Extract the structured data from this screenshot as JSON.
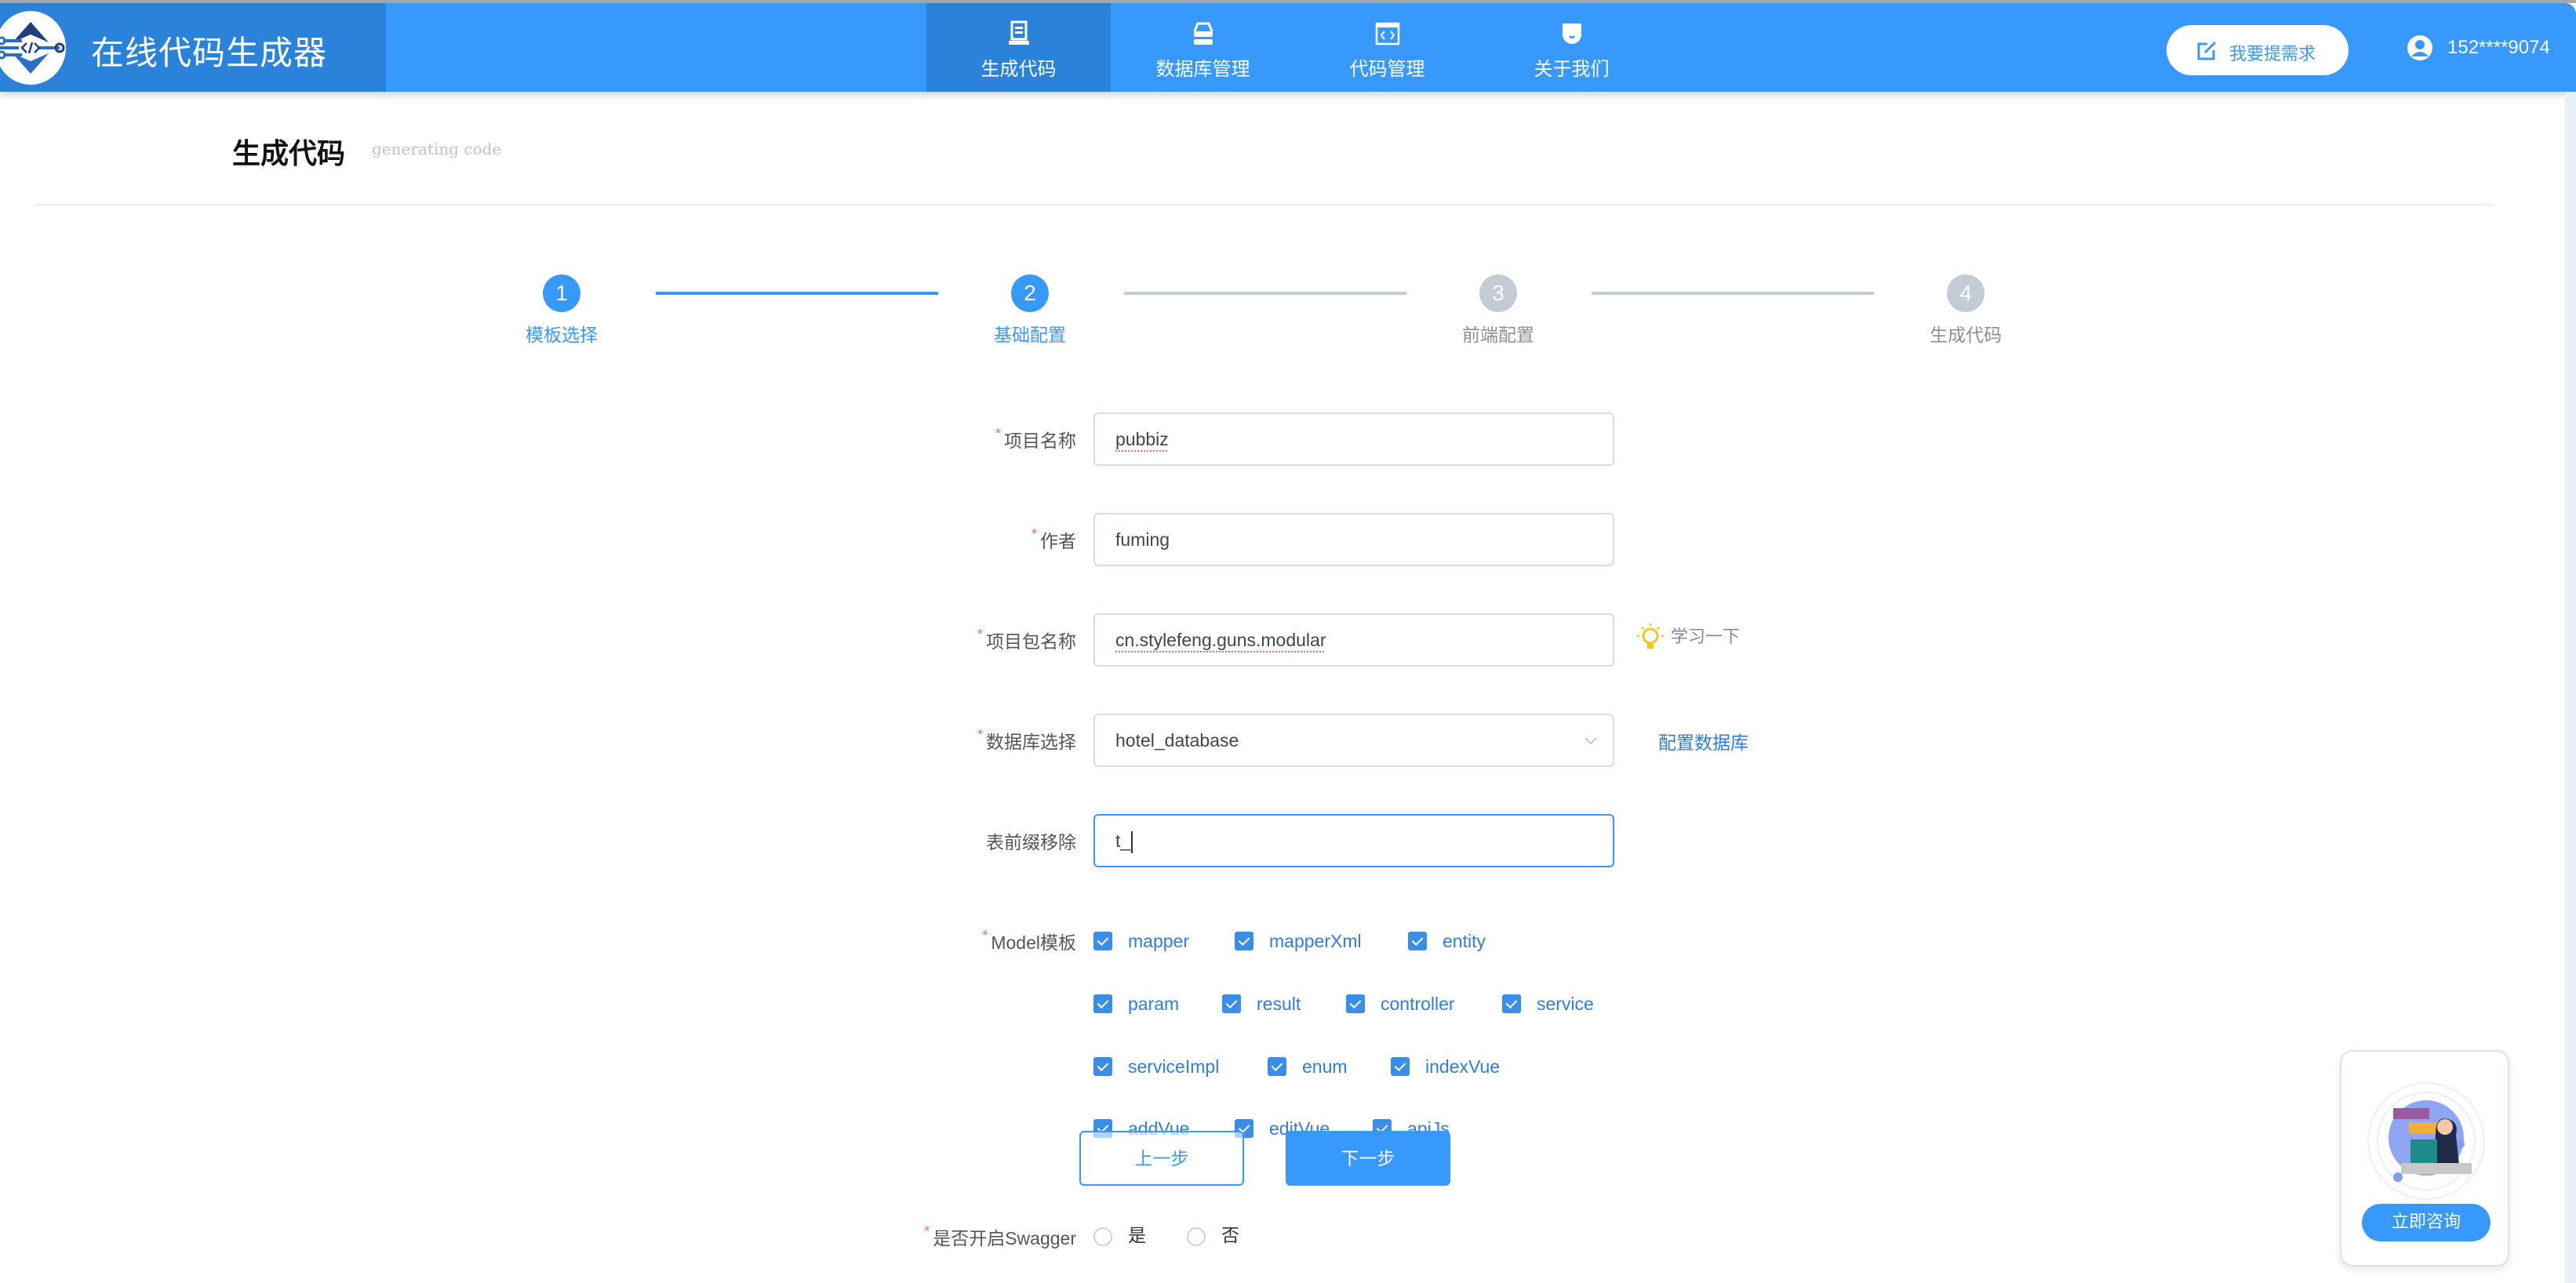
{
  "app": {
    "title": "在线代码生成器",
    "logo_icon": "circuit-code-logo"
  },
  "nav": {
    "items": [
      {
        "label": "生成代码",
        "icon": "monitor-icon",
        "active": true
      },
      {
        "label": "数据库管理",
        "icon": "database-icon",
        "active": false
      },
      {
        "label": "代码管理",
        "icon": "code-window-icon",
        "active": false
      },
      {
        "label": "关于我们",
        "icon": "about-icon",
        "active": false
      }
    ]
  },
  "header_right": {
    "request_button": "我要提需求",
    "request_icon": "edit-icon",
    "user_icon": "user-icon",
    "user_phone": "152****9074"
  },
  "page": {
    "title": "生成代码",
    "subtitle": "generating code"
  },
  "steps": [
    {
      "number": "1",
      "label": "模板选择",
      "status": "done"
    },
    {
      "number": "2",
      "label": "基础配置",
      "status": "done"
    },
    {
      "number": "3",
      "label": "前端配置",
      "status": "todo"
    },
    {
      "number": "4",
      "label": "生成代码",
      "status": "todo"
    }
  ],
  "form": {
    "project_name": {
      "label": "项目名称",
      "required": true,
      "value": "pubbiz"
    },
    "author": {
      "label": "作者",
      "required": true,
      "value": "fuming"
    },
    "package_name": {
      "label": "项目包名称",
      "required": true,
      "value": "cn.stylefeng.guns.modular",
      "hint": "学习一下",
      "hint_icon": "lightbulb-icon"
    },
    "database": {
      "label": "数据库选择",
      "required": true,
      "value": "hotel_database",
      "link": "配置数据库"
    },
    "table_prefix": {
      "label": "表前缀移除",
      "required": false,
      "value": "t_"
    },
    "model_templates": {
      "label": "Model模板",
      "required": true,
      "options": [
        {
          "label": "mapper",
          "checked": true
        },
        {
          "label": "mapperXml",
          "checked": true
        },
        {
          "label": "entity",
          "checked": true
        },
        {
          "label": "param",
          "checked": true
        },
        {
          "label": "result",
          "checked": true
        },
        {
          "label": "controller",
          "checked": true
        },
        {
          "label": "service",
          "checked": true
        },
        {
          "label": "serviceImpl",
          "checked": true
        },
        {
          "label": "enum",
          "checked": true
        },
        {
          "label": "indexVue",
          "checked": true
        },
        {
          "label": "addVue",
          "checked": true
        },
        {
          "label": "editVue",
          "checked": true
        },
        {
          "label": "apiJs",
          "checked": true
        }
      ]
    },
    "swagger": {
      "label": "是否开启Swagger",
      "required": true,
      "options": [
        "是",
        "否"
      ],
      "selected": null
    }
  },
  "buttons": {
    "prev": "上一步",
    "next": "下一步"
  },
  "consult": {
    "button": "立即咨询",
    "illustration": "customer-service-illustration"
  },
  "colors": {
    "primary": "#3899FC",
    "brand_dark": "#2B82D9",
    "inactive": "#C3CCD5",
    "required": "#F56C6C",
    "link": "#2F7DE1"
  }
}
